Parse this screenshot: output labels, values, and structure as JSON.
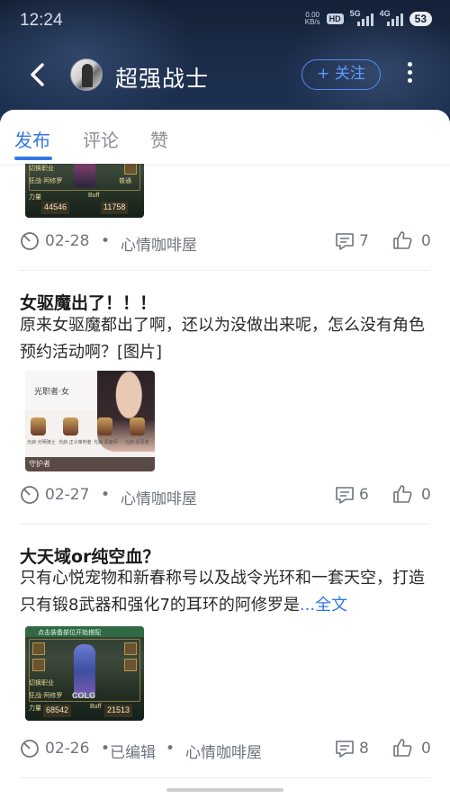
{
  "status_bar": {
    "time": "12:24",
    "net_speed_value": "0.00",
    "net_speed_unit": "KB/s",
    "hd_badge": "HD",
    "sig1_label": "5G",
    "sig2_label": "4G",
    "battery": "53"
  },
  "header": {
    "back_icon": "chevron-left-icon",
    "nickname": "超强战士",
    "follow_label": "+ 关注",
    "more_icon": "more-vertical-icon",
    "accent_color": "#3477e6"
  },
  "tabs": [
    {
      "label": "发布",
      "active": true
    },
    {
      "label": "评论",
      "active": false
    },
    {
      "label": "赞",
      "active": false
    }
  ],
  "posts": [
    {
      "image_kind": "game-equipment-screenshot",
      "image_stats": [
        "44546",
        "11758"
      ],
      "image_texts": [
        "切换职业",
        "狂战·阿修罗",
        "COLG",
        "普通",
        "力量",
        "Buff"
      ],
      "date": "02-28",
      "circle": "心情咖啡屋",
      "comments": "7",
      "likes": "0"
    },
    {
      "title": "女驱魔出了！！！",
      "body": "原来女驱魔都出了啊，还以为没做出来呢，怎么没有角色预约活动啊？[图片]",
      "image_kind": "character-select-screenshot",
      "image_texts": [
        "光职者·女",
        "光启·光明骑士",
        "光启·正义审判者",
        "光启·驱魔师",
        "光启·惩恶者",
        "守护者"
      ],
      "date": "02-27",
      "circle": "心情咖啡屋",
      "comments": "6",
      "likes": "0"
    },
    {
      "title": "大天域or纯空血？",
      "body": " 只有心悦宠物和新春称号以及战令光环和一套天空，打造只有锻8武器和强化7的耳环的阿修罗是",
      "read_more": "...全文",
      "image_kind": "game-equipment-screenshot",
      "image_stats": [
        "68542",
        "21513"
      ],
      "image_texts": [
        "点击装备部位开始搭配",
        "切换职业",
        "狂战·阿修罗",
        "COLG",
        "力量",
        "Buff"
      ],
      "date": "02-26",
      "edited": "已编辑",
      "circle": "心情咖啡屋",
      "comments": "8",
      "likes": "0"
    }
  ],
  "meta": {
    "separator": "•",
    "clock_icon": "clock-icon",
    "comment_icon": "comment-icon",
    "like_icon": "thumbs-up-icon"
  }
}
